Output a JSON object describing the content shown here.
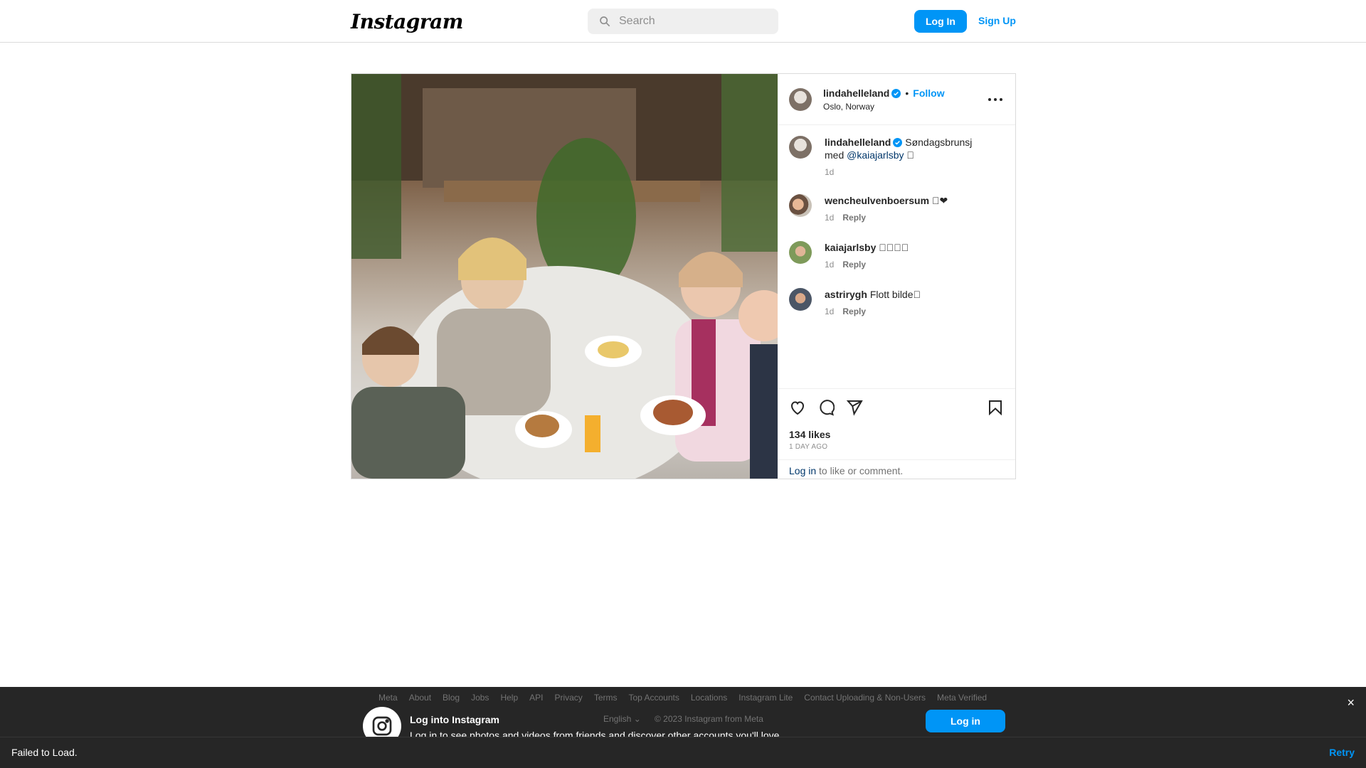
{
  "header": {
    "logo": "Instagram",
    "search_placeholder": "Search",
    "login": "Log In",
    "signup": "Sign Up"
  },
  "post": {
    "author": "lindahelleland",
    "follow": "Follow",
    "location": "Oslo, Norway",
    "caption": {
      "user": "lindahelleland",
      "text_before": "Søndagsbrunsj med ",
      "mention": "@kaiajarlsby",
      "text_after": " \u0000",
      "time": "1d"
    },
    "comments": [
      {
        "user": "wencheulvenboersum",
        "text": "\u0000❤",
        "time": "1d",
        "reply": "Reply"
      },
      {
        "user": "kaiajarlsby",
        "text": "\u0000\u0000\u0000\u0000",
        "time": "1d",
        "reply": "Reply"
      },
      {
        "user": "astrirygh",
        "text": "Flott bilde\u0000",
        "time": "1d",
        "reply": "Reply"
      }
    ],
    "likes": "134 likes",
    "posted": "1 DAY AGO",
    "login_prompt_link": "Log in",
    "login_prompt_text": " to like or comment."
  },
  "footer": {
    "links": [
      "Meta",
      "About",
      "Blog",
      "Jobs",
      "Help",
      "API",
      "Privacy",
      "Terms",
      "Top Accounts",
      "Locations",
      "Instagram Lite",
      "Contact Uploading & Non-Users",
      "Meta Verified"
    ],
    "banner_title": "Log into Instagram",
    "banner_sub": "Log in to see photos and videos from friends and discover other accounts you'll love.",
    "language": "English",
    "copyright": "© 2023 Instagram from Meta",
    "banner_login": "Log in"
  },
  "status": {
    "message": "Failed to Load.",
    "retry": "Retry"
  },
  "colors": {
    "accent": "#0095f6",
    "mention": "#00376b",
    "overlay": "#262626"
  }
}
